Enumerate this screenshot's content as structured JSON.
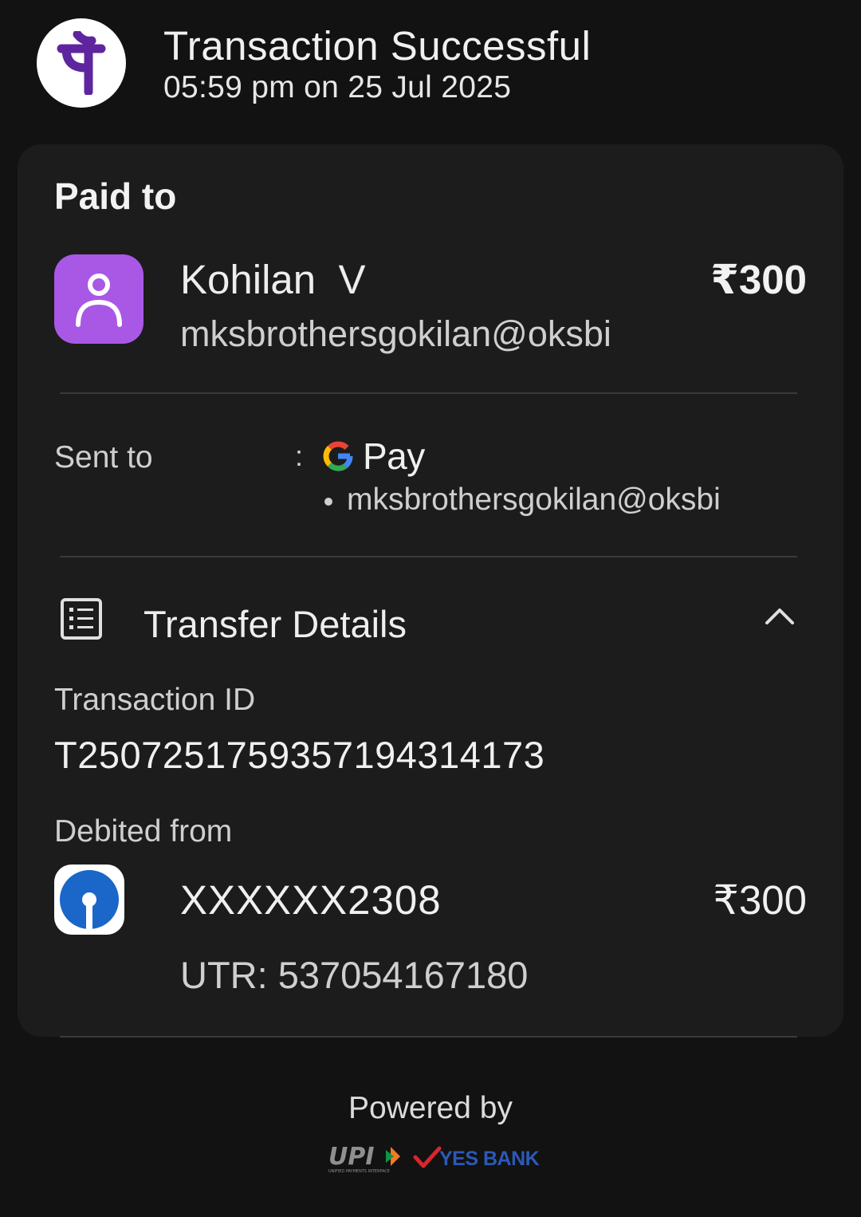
{
  "header": {
    "title": "Transaction Successful",
    "timestamp": "05:59 pm on 25 Jul 2025",
    "app_icon": "phonepe-logo",
    "brand_color": "#5f259f"
  },
  "paid_to": {
    "label": "Paid to",
    "name": "Kohilan  V",
    "upi_id": "mksbrothersgokilan@oksbi",
    "amount": "₹300",
    "avatar_icon": "person-icon",
    "avatar_color": "#a958e6"
  },
  "sent_to": {
    "label": "Sent to",
    "separator": ":",
    "app_name": "Pay",
    "app_icon": "google-g-icon",
    "upi_id": "mksbrothersgokilan@oksbi"
  },
  "transfer_details": {
    "title": "Transfer Details",
    "icon": "receipt-list-icon",
    "toggle_icon": "chevron-up-icon",
    "transaction_id_label": "Transaction ID",
    "transaction_id": "T2507251759357194314173",
    "debited_from_label": "Debited from",
    "account": "XXXXXX2308",
    "amount": "₹300",
    "utr": "UTR: 537054167180",
    "bank_icon": "sbi-logo"
  },
  "footer": {
    "powered_by": "Powered by",
    "upi_logo_text": "UPI",
    "upi_subtext": "UNIFIED PAYMENTS INTERFACE",
    "bank_name": "YES BANK",
    "bank_color": "#2c59b8"
  }
}
